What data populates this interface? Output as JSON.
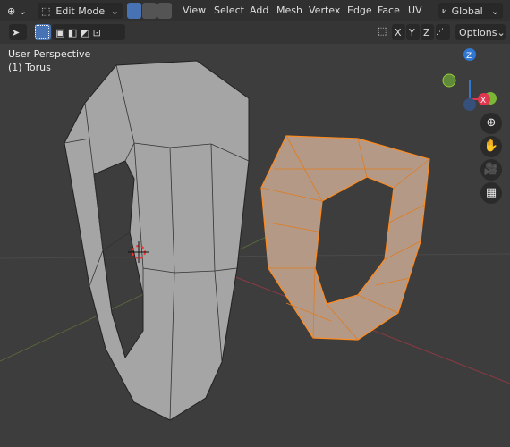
{
  "header": {
    "mode": "Edit Mode",
    "menus": [
      "View",
      "Select",
      "Add",
      "Mesh",
      "Vertex",
      "Edge",
      "Face",
      "UV"
    ],
    "orientation": "Global"
  },
  "toolbar": {
    "axes": [
      "X",
      "Y",
      "Z"
    ],
    "options": "Options"
  },
  "viewport": {
    "view_name": "User Perspective",
    "object_name": "(1) Torus",
    "gizmo": {
      "z": "Z",
      "x": "X",
      "y": "Y"
    }
  },
  "colors": {
    "accent": "#4772b3",
    "selection": "#ff8a1f",
    "x_axis": "#e0364f",
    "y_axis": "#7bb736",
    "z_axis": "#2f77d0"
  },
  "nav_icons": [
    "zoom-icon",
    "hand-pan-icon",
    "camera-icon",
    "grid-perspective-icon"
  ]
}
